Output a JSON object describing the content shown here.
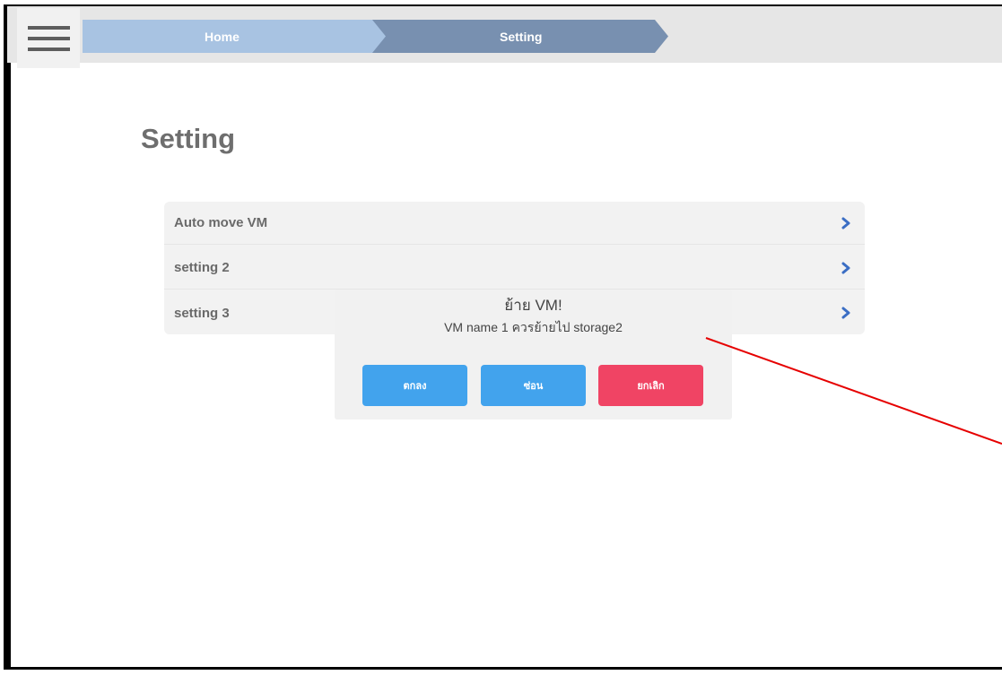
{
  "breadcrumb": {
    "home_label": "Home",
    "current_label": "Setting"
  },
  "page": {
    "title": "Setting"
  },
  "settings": {
    "items": [
      {
        "label": "Auto move VM"
      },
      {
        "label": "setting 2"
      },
      {
        "label": "setting 3"
      }
    ]
  },
  "dialog": {
    "title": "ย้าย VM!",
    "message": "VM name 1 ควรย้ายไป storage2",
    "ok_label": "ตกลง",
    "hide_label": "ซ่อน",
    "cancel_label": "ยกเลิก"
  },
  "colors": {
    "breadcrumb_home": "#a8c3e2",
    "breadcrumb_current": "#7890b0",
    "primary_button": "#42a3ed",
    "danger_button": "#f04464",
    "chevron": "#3b6ec4",
    "annotation": "#e60000"
  },
  "icons": {
    "menu": "hamburger-icon",
    "item_arrow": "chevron-right-icon"
  }
}
